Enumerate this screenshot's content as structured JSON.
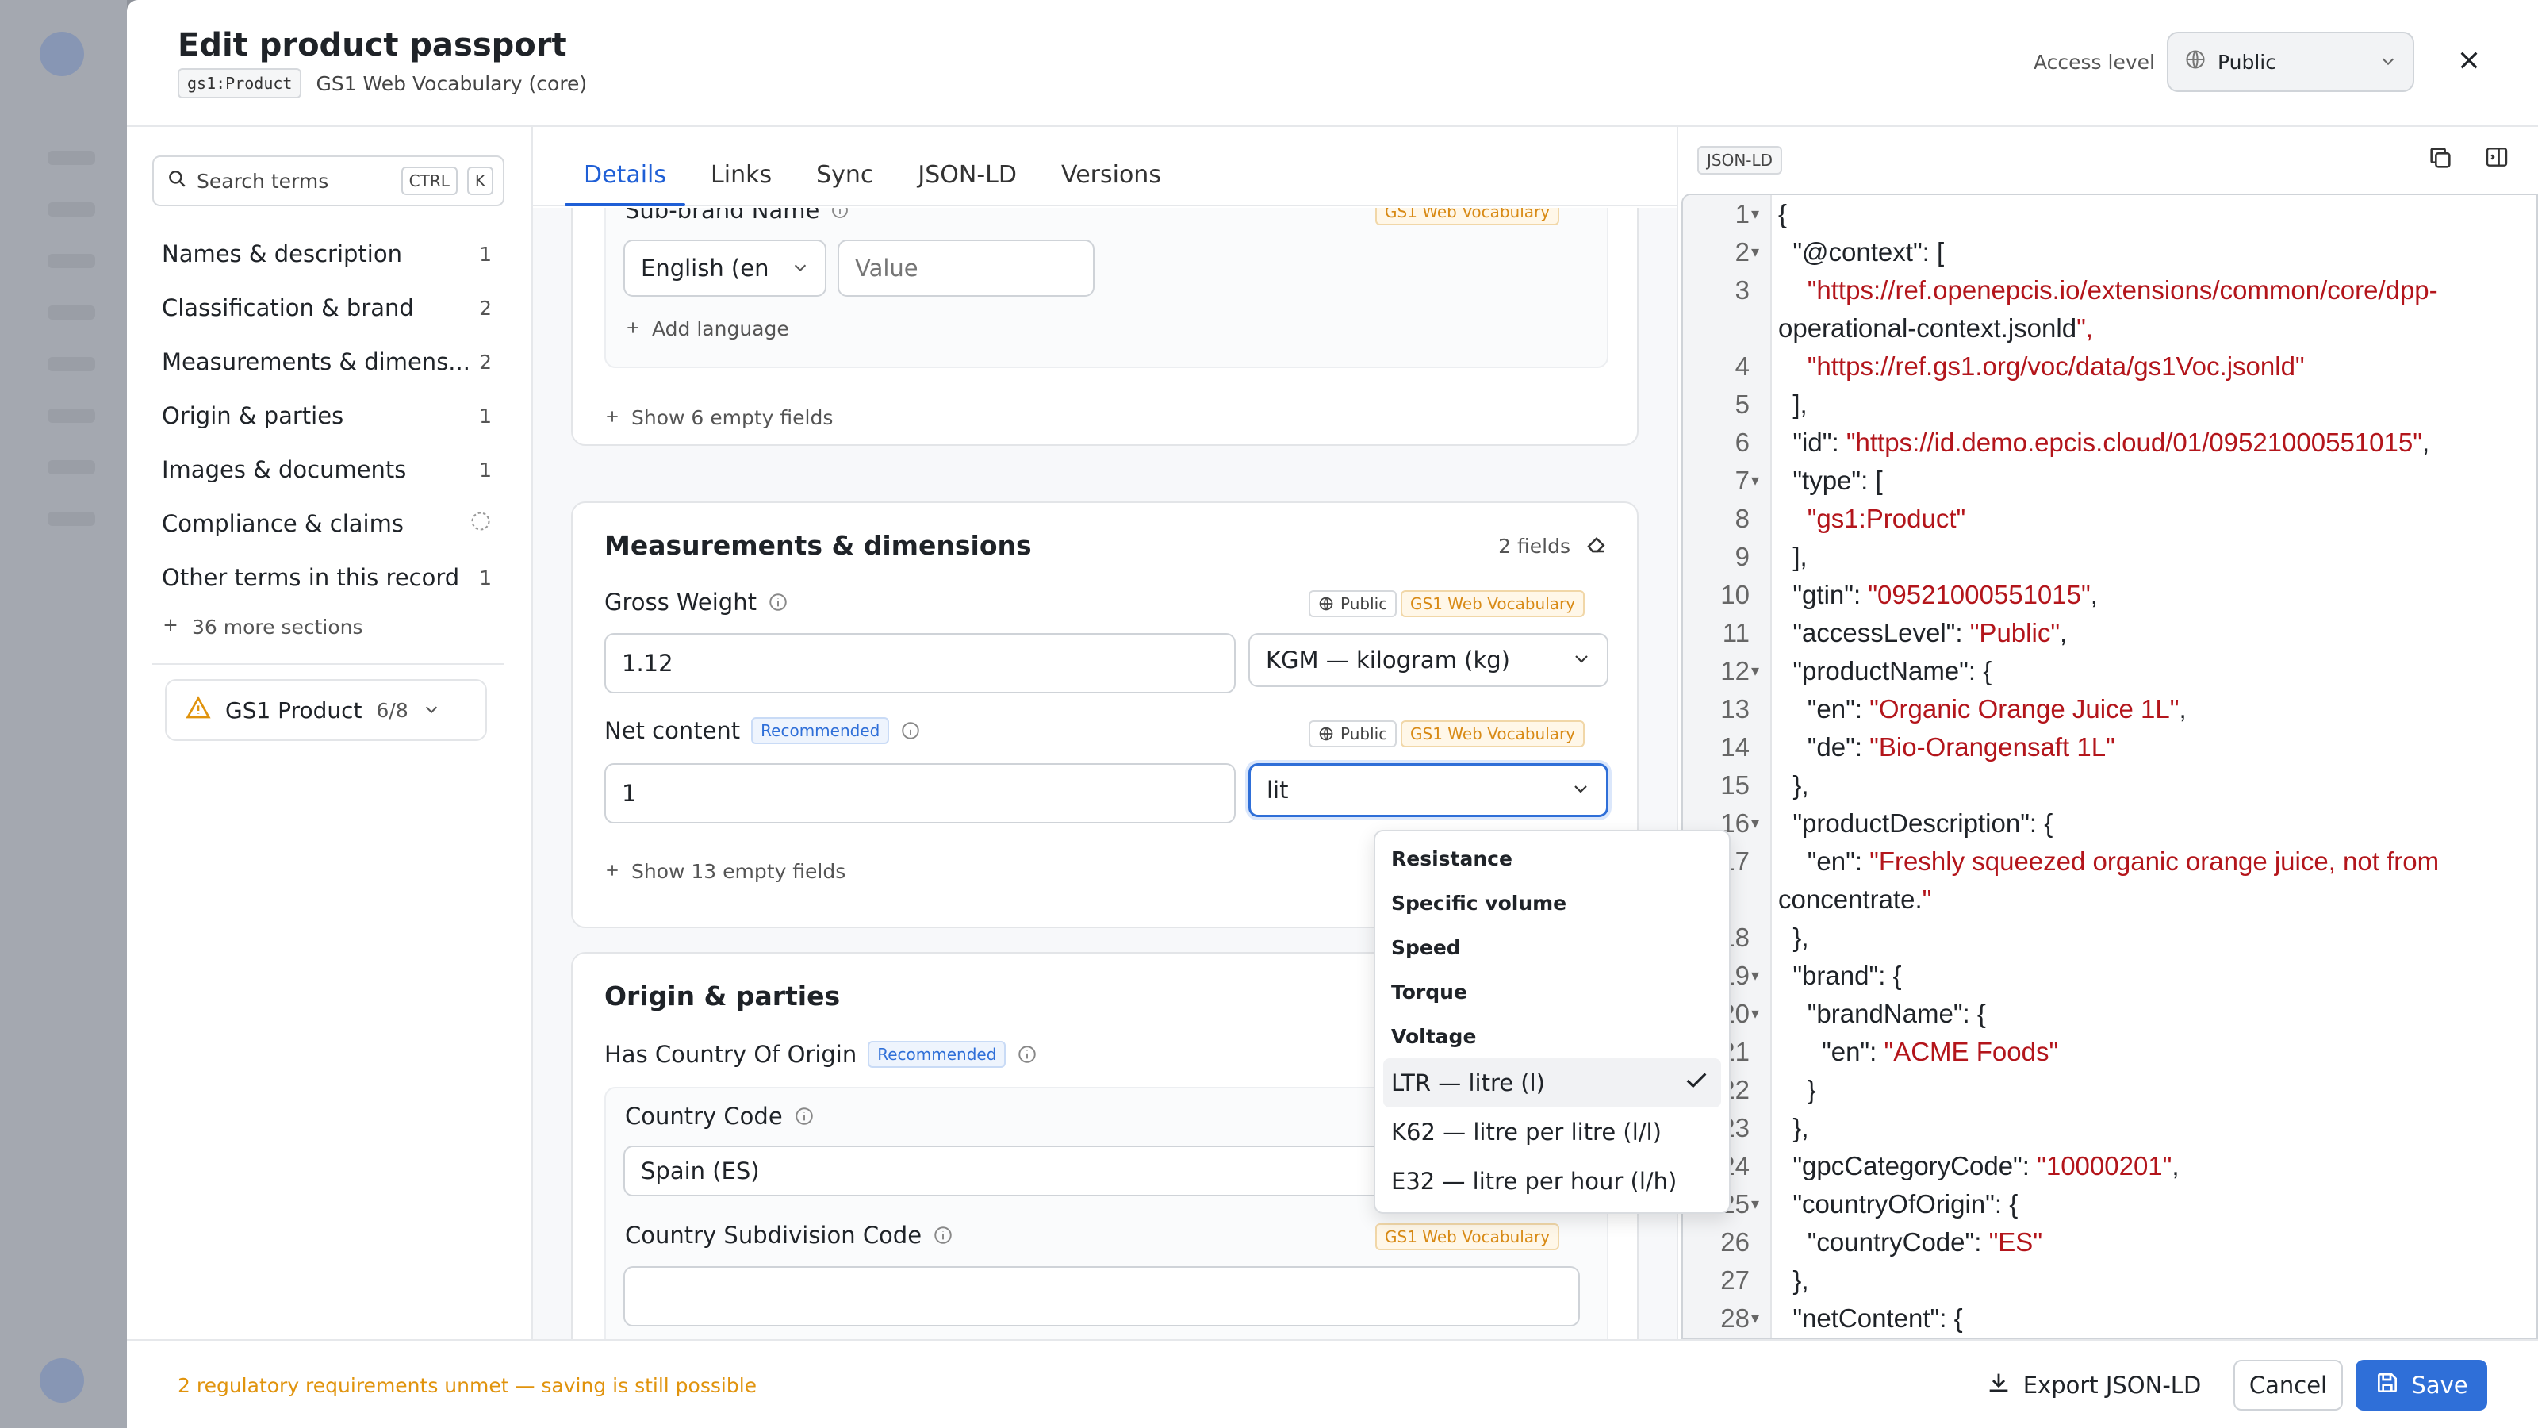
{
  "header": {
    "title": "Edit product passport",
    "type_chip": "gs1:Product",
    "vocabulary": "GS1 Web Vocabulary (core)",
    "access_label": "Access level",
    "access_value": "Public"
  },
  "sidebar": {
    "search_placeholder": "Search terms",
    "kbd_ctrl": "CTRL",
    "kbd_k": "K",
    "items": [
      {
        "label": "Names & description",
        "count": "1"
      },
      {
        "label": "Classification & brand",
        "count": "2"
      },
      {
        "label": "Measurements & dimens...",
        "count": "2"
      },
      {
        "label": "Origin & parties",
        "count": "1"
      },
      {
        "label": "Images & documents",
        "count": "1"
      },
      {
        "label": "Compliance & claims",
        "count": ""
      },
      {
        "label": "Other terms in this record",
        "count": "1"
      }
    ],
    "more_sections": "36 more sections",
    "product_name": "GS1 Product",
    "product_ratio": "6/8"
  },
  "tabs": [
    "Details",
    "Links",
    "Sync",
    "JSON-LD",
    "Versions"
  ],
  "main": {
    "subbrand": {
      "label": "Sub-brand Name",
      "badge": "GS1 Web Vocabulary",
      "language": "English (en",
      "value_placeholder": "Value",
      "add_language": "Add language",
      "show_empty": "Show 6 empty fields"
    },
    "measurements": {
      "title": "Measurements & dimensions",
      "fields_count": "2 fields",
      "gross_weight": {
        "label": "Gross Weight",
        "visibility": "Public",
        "badge": "GS1 Web Vocabulary",
        "value": "1.12",
        "unit": "KGM — kilogram (kg)"
      },
      "net_content": {
        "label": "Net content",
        "recommended": "Recommended",
        "visibility": "Public",
        "badge": "GS1 Web Vocabulary",
        "value": "1",
        "unit_search": "lit"
      },
      "show_empty": "Show 13 empty fields"
    },
    "origin": {
      "title": "Origin & parties",
      "has_country": "Has Country Of Origin",
      "recommended": "Recommended",
      "country_code_label": "Country Code",
      "country_code_value": "Spain (ES)",
      "subdivision_label": "Country Subdivision Code",
      "badge": "GS1 Web Vocabulary"
    }
  },
  "dropdown": {
    "groups": [
      "Resistance",
      "Specific volume",
      "Speed",
      "Torque",
      "Voltage"
    ],
    "options": [
      {
        "label": "LTR — litre (l)",
        "selected": true
      },
      {
        "label": "K62 — litre per litre (l/l)",
        "selected": false
      },
      {
        "label": "E32 — litre per hour (l/h)",
        "selected": false
      }
    ]
  },
  "json_panel": {
    "tag": "JSON-LD",
    "lines": [
      {
        "n": "1",
        "fold": true,
        "text": "{"
      },
      {
        "n": "2",
        "fold": true,
        "text": "  \"@context\": ["
      },
      {
        "n": "3",
        "fold": false,
        "text": "    \"https://ref.openepcis.io/extensions/common/core/dpp-"
      },
      {
        "n": "",
        "fold": false,
        "text": "operational-context.jsonld\","
      },
      {
        "n": "4",
        "fold": false,
        "text": "    \"https://ref.gs1.org/voc/data/gs1Voc.jsonld\""
      },
      {
        "n": "5",
        "fold": false,
        "text": "  ],"
      },
      {
        "n": "6",
        "fold": false,
        "text": "  \"id\": \"https://id.demo.epcis.cloud/01/09521000551015\","
      },
      {
        "n": "7",
        "fold": true,
        "text": "  \"type\": ["
      },
      {
        "n": "8",
        "fold": false,
        "text": "    \"gs1:Product\""
      },
      {
        "n": "9",
        "fold": false,
        "text": "  ],"
      },
      {
        "n": "10",
        "fold": false,
        "text": "  \"gtin\": \"09521000551015\","
      },
      {
        "n": "11",
        "fold": false,
        "text": "  \"accessLevel\": \"Public\","
      },
      {
        "n": "12",
        "fold": true,
        "text": "  \"productName\": {"
      },
      {
        "n": "13",
        "fold": false,
        "text": "    \"en\": \"Organic Orange Juice 1L\","
      },
      {
        "n": "14",
        "fold": false,
        "text": "    \"de\": \"Bio-Orangensaft 1L\""
      },
      {
        "n": "15",
        "fold": false,
        "text": "  },"
      },
      {
        "n": "16",
        "fold": true,
        "text": "  \"productDescription\": {"
      },
      {
        "n": "17",
        "fold": false,
        "text": "    \"en\": \"Freshly squeezed organic orange juice, not from"
      },
      {
        "n": "",
        "fold": false,
        "text": "concentrate.\""
      },
      {
        "n": "18",
        "fold": false,
        "text": "  },"
      },
      {
        "n": "19",
        "fold": true,
        "text": "  \"brand\": {"
      },
      {
        "n": "20",
        "fold": true,
        "text": "    \"brandName\": {"
      },
      {
        "n": "21",
        "fold": false,
        "text": "      \"en\": \"ACME Foods\""
      },
      {
        "n": "22",
        "fold": false,
        "text": "    }"
      },
      {
        "n": "23",
        "fold": false,
        "text": "  },"
      },
      {
        "n": "24",
        "fold": false,
        "text": "  \"gpcCategoryCode\": \"10000201\","
      },
      {
        "n": "25",
        "fold": true,
        "text": "  \"countryOfOrigin\": {"
      },
      {
        "n": "26",
        "fold": false,
        "text": "    \"countryCode\": \"ES\""
      },
      {
        "n": "27",
        "fold": false,
        "text": "  },"
      },
      {
        "n": "28",
        "fold": true,
        "text": "  \"netContent\": {"
      }
    ]
  },
  "footer": {
    "warning": "2 regulatory requirements unmet — saving is still possible",
    "export": "Export JSON-LD",
    "cancel": "Cancel",
    "save": "Save"
  },
  "colors": {
    "accent": "#2f6fd8",
    "warning": "#e0930d",
    "json_string": "#b3151b",
    "badge_gs1": "#d88a15"
  }
}
